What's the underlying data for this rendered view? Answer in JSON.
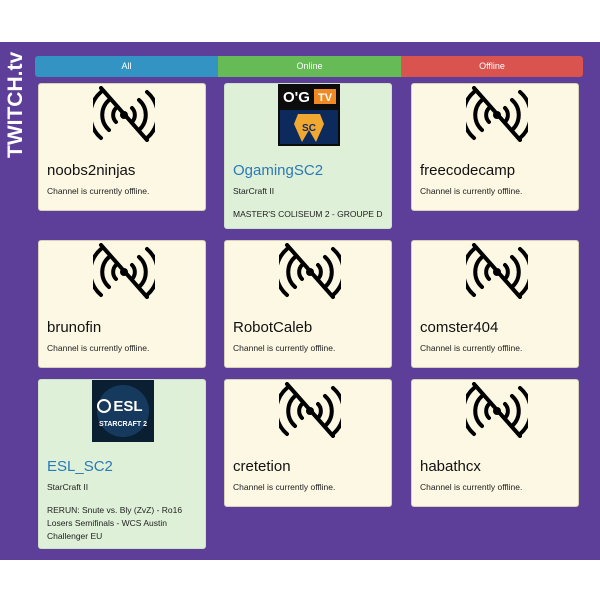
{
  "brand": "TWITCH.tv",
  "tabs": {
    "all": "All",
    "online": "Online",
    "offline": "Offline"
  },
  "colors": {
    "panel": "#5d3f9a",
    "all": "#3394c4",
    "online": "#66bb56",
    "offline": "#d9534f",
    "offline_card": "#fcf8e3",
    "online_card": "#dff0d8",
    "link": "#2a79b8"
  },
  "channels": [
    {
      "name": "noobs2ninjas",
      "status": "Channel is currently offline.",
      "icon": "offline-icon"
    },
    {
      "name": "OgamingSC2",
      "game": "StarCraft II",
      "title": "MASTER'S COLISEUM 2 - GROUPE D",
      "logo": {
        "top": "O'G",
        "badge": "TV",
        "emblem": "SC"
      }
    },
    {
      "name": "freecodecamp",
      "status": "Channel is currently offline.",
      "icon": "offline-icon"
    },
    {
      "name": "brunofin",
      "status": "Channel is currently offline.",
      "icon": "offline-icon"
    },
    {
      "name": "RobotCaleb",
      "status": "Channel is currently offline.",
      "icon": "offline-icon"
    },
    {
      "name": "comster404",
      "status": "Channel is currently offline.",
      "icon": "offline-icon"
    },
    {
      "name": "ESL_SC2",
      "game": "StarCraft II",
      "title": "RERUN: Snute vs. Bly (ZvZ) - Ro16 Losers Semifinals - WCS Austin Challenger EU",
      "logo": {
        "top": "ESL",
        "bottom": "STARCRAFT 2"
      }
    },
    {
      "name": "cretetion",
      "status": "Channel is currently offline.",
      "icon": "offline-icon"
    },
    {
      "name": "habathcx",
      "status": "Channel is currently offline.",
      "icon": "offline-icon"
    }
  ]
}
